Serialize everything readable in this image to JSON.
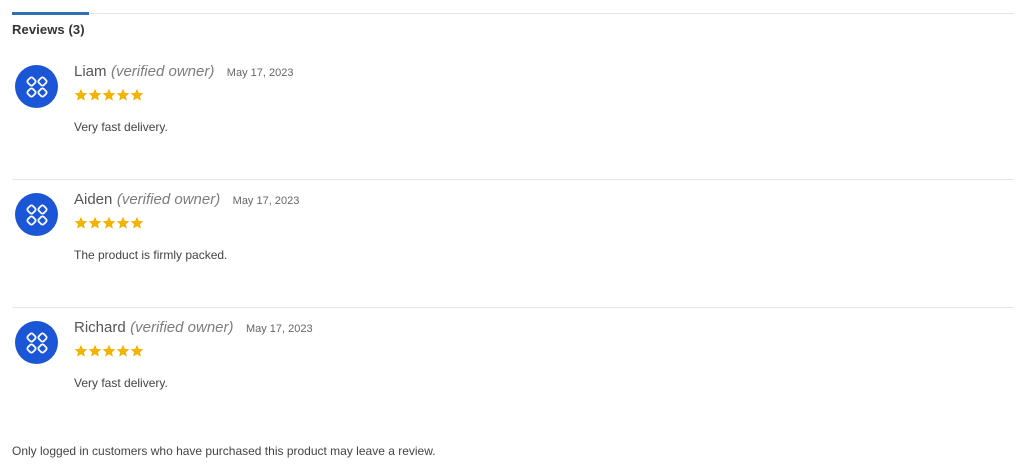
{
  "tab": {
    "title": "Reviews (3)",
    "accent_color": "#2f6fb3"
  },
  "reviews": [
    {
      "author": "Liam",
      "owner_label": "(verified owner)",
      "date": "May 17, 2023",
      "rating": 5,
      "text": "Very fast delivery.",
      "avatar_icon": "avatar-pattern-icon"
    },
    {
      "author": "Aiden",
      "owner_label": "(verified owner)",
      "date": "May 17, 2023",
      "rating": 5,
      "text": "The product is firmly packed.",
      "avatar_icon": "avatar-pattern-icon"
    },
    {
      "author": "Richard",
      "owner_label": "(verified owner)",
      "date": "May 17, 2023",
      "rating": 5,
      "text": "Very fast delivery.",
      "avatar_icon": "avatar-pattern-icon"
    }
  ],
  "footer_note": "Only logged in customers who have purchased this product may leave a review.",
  "colors": {
    "star": "#f5b301",
    "avatar": "#1a56d6"
  }
}
